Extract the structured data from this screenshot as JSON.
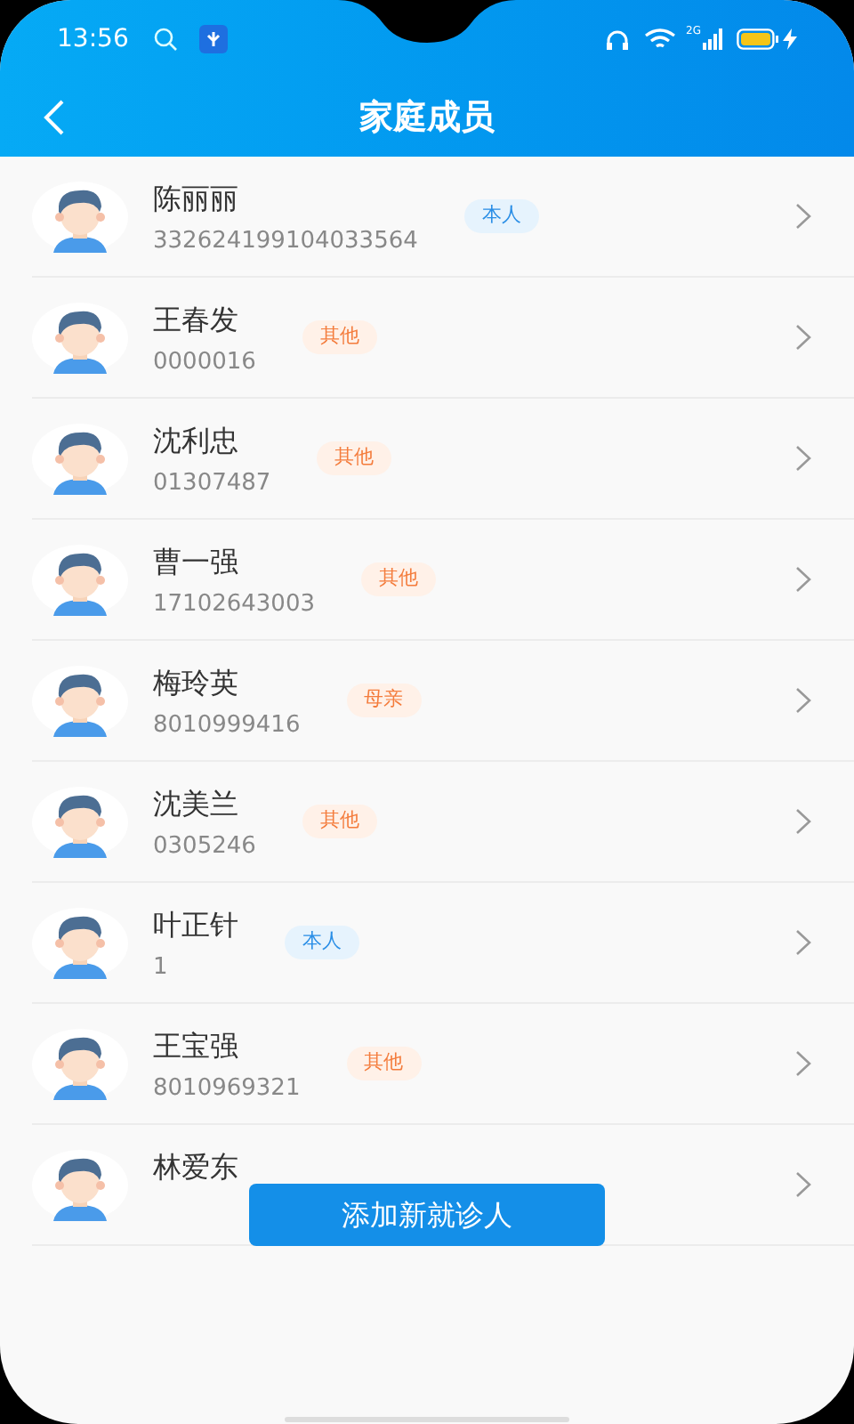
{
  "status_bar": {
    "time": "13:56",
    "network": "2G"
  },
  "header": {
    "title": "家庭成员"
  },
  "members": [
    {
      "name": "陈丽丽",
      "id": "332624199104033564",
      "tag": "本人",
      "kind": "self"
    },
    {
      "name": "王春发",
      "id": "0000016",
      "tag": "其他",
      "kind": "other"
    },
    {
      "name": "沈利忠",
      "id": "01307487",
      "tag": "其他",
      "kind": "other"
    },
    {
      "name": "曹一强",
      "id": "17102643003",
      "tag": "其他",
      "kind": "other"
    },
    {
      "name": "梅玲英",
      "id": "8010999416",
      "tag": "母亲",
      "kind": "other"
    },
    {
      "name": "沈美兰",
      "id": "0305246",
      "tag": "其他",
      "kind": "other"
    },
    {
      "name": "叶正针",
      "id": "1",
      "tag": "本人",
      "kind": "self"
    },
    {
      "name": "王宝强",
      "id": "8010969321",
      "tag": "其他",
      "kind": "other"
    },
    {
      "name": "林爱东"
    }
  ],
  "add_button": {
    "label": "添加新就诊人"
  }
}
